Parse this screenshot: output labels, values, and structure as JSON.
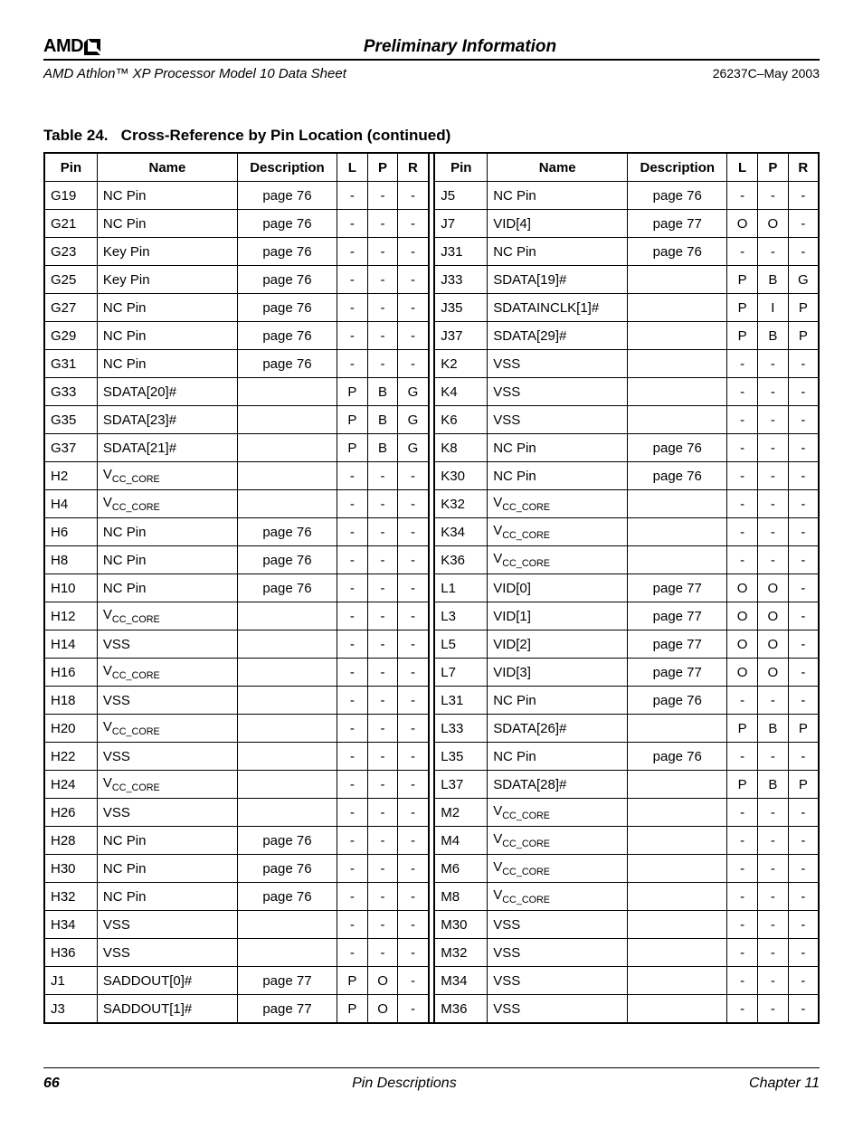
{
  "header": {
    "logo": "AMD",
    "preliminary": "Preliminary Information",
    "doc_title": "AMD Athlon™ XP Processor Model 10 Data Sheet",
    "doc_id": "26237C–May 2003"
  },
  "table": {
    "caption_prefix": "Table 24.",
    "caption_body": "Cross-Reference by Pin Location",
    "caption_suffix": "(continued)",
    "headers": {
      "pin": "Pin",
      "name": "Name",
      "desc": "Description",
      "l": "L",
      "p": "P",
      "r": "R"
    },
    "left": [
      {
        "pin": "G19",
        "name": "NC Pin",
        "desc": "page 76",
        "l": "-",
        "p": "-",
        "r": "-"
      },
      {
        "pin": "G21",
        "name": "NC Pin",
        "desc": "page 76",
        "l": "-",
        "p": "-",
        "r": "-"
      },
      {
        "pin": "G23",
        "name": "Key Pin",
        "desc": "page 76",
        "l": "-",
        "p": "-",
        "r": "-"
      },
      {
        "pin": "G25",
        "name": "Key Pin",
        "desc": "page 76",
        "l": "-",
        "p": "-",
        "r": "-"
      },
      {
        "pin": "G27",
        "name": "NC Pin",
        "desc": "page 76",
        "l": "-",
        "p": "-",
        "r": "-"
      },
      {
        "pin": "G29",
        "name": "NC Pin",
        "desc": "page 76",
        "l": "-",
        "p": "-",
        "r": "-"
      },
      {
        "pin": "G31",
        "name": "NC Pin",
        "desc": "page 76",
        "l": "-",
        "p": "-",
        "r": "-"
      },
      {
        "pin": "G33",
        "name": "SDATA[20]#",
        "desc": "",
        "l": "P",
        "p": "B",
        "r": "G"
      },
      {
        "pin": "G35",
        "name": "SDATA[23]#",
        "desc": "",
        "l": "P",
        "p": "B",
        "r": "G"
      },
      {
        "pin": "G37",
        "name": "SDATA[21]#",
        "desc": "",
        "l": "P",
        "p": "B",
        "r": "G"
      },
      {
        "pin": "H2",
        "name": "VCC_CORE",
        "desc": "",
        "l": "-",
        "p": "-",
        "r": "-"
      },
      {
        "pin": "H4",
        "name": "VCC_CORE",
        "desc": "",
        "l": "-",
        "p": "-",
        "r": "-"
      },
      {
        "pin": "H6",
        "name": "NC Pin",
        "desc": "page 76",
        "l": "-",
        "p": "-",
        "r": "-"
      },
      {
        "pin": "H8",
        "name": "NC Pin",
        "desc": "page 76",
        "l": "-",
        "p": "-",
        "r": "-"
      },
      {
        "pin": "H10",
        "name": "NC Pin",
        "desc": "page 76",
        "l": "-",
        "p": "-",
        "r": "-"
      },
      {
        "pin": "H12",
        "name": "VCC_CORE",
        "desc": "",
        "l": "-",
        "p": "-",
        "r": "-"
      },
      {
        "pin": "H14",
        "name": "VSS",
        "desc": "",
        "l": "-",
        "p": "-",
        "r": "-"
      },
      {
        "pin": "H16",
        "name": "VCC_CORE",
        "desc": "",
        "l": "-",
        "p": "-",
        "r": "-"
      },
      {
        "pin": "H18",
        "name": "VSS",
        "desc": "",
        "l": "-",
        "p": "-",
        "r": "-"
      },
      {
        "pin": "H20",
        "name": "VCC_CORE",
        "desc": "",
        "l": "-",
        "p": "-",
        "r": "-"
      },
      {
        "pin": "H22",
        "name": "VSS",
        "desc": "",
        "l": "-",
        "p": "-",
        "r": "-"
      },
      {
        "pin": "H24",
        "name": "VCC_CORE",
        "desc": "",
        "l": "-",
        "p": "-",
        "r": "-"
      },
      {
        "pin": "H26",
        "name": "VSS",
        "desc": "",
        "l": "-",
        "p": "-",
        "r": "-"
      },
      {
        "pin": "H28",
        "name": "NC Pin",
        "desc": "page 76",
        "l": "-",
        "p": "-",
        "r": "-"
      },
      {
        "pin": "H30",
        "name": "NC Pin",
        "desc": "page 76",
        "l": "-",
        "p": "-",
        "r": "-"
      },
      {
        "pin": "H32",
        "name": "NC Pin",
        "desc": "page 76",
        "l": "-",
        "p": "-",
        "r": "-"
      },
      {
        "pin": "H34",
        "name": "VSS",
        "desc": "",
        "l": "-",
        "p": "-",
        "r": "-"
      },
      {
        "pin": "H36",
        "name": "VSS",
        "desc": "",
        "l": "-",
        "p": "-",
        "r": "-"
      },
      {
        "pin": "J1",
        "name": "SADDOUT[0]#",
        "desc": "page 77",
        "l": "P",
        "p": "O",
        "r": "-"
      },
      {
        "pin": "J3",
        "name": "SADDOUT[1]#",
        "desc": "page 77",
        "l": "P",
        "p": "O",
        "r": "-"
      }
    ],
    "right": [
      {
        "pin": "J5",
        "name": "NC Pin",
        "desc": "page 76",
        "l": "-",
        "p": "-",
        "r": "-"
      },
      {
        "pin": "J7",
        "name": "VID[4]",
        "desc": "page 77",
        "l": "O",
        "p": "O",
        "r": "-"
      },
      {
        "pin": "J31",
        "name": "NC Pin",
        "desc": "page 76",
        "l": "-",
        "p": "-",
        "r": "-"
      },
      {
        "pin": "J33",
        "name": "SDATA[19]#",
        "desc": "",
        "l": "P",
        "p": "B",
        "r": "G"
      },
      {
        "pin": "J35",
        "name": "SDATAINCLK[1]#",
        "desc": "",
        "l": "P",
        "p": "I",
        "r": "P"
      },
      {
        "pin": "J37",
        "name": "SDATA[29]#",
        "desc": "",
        "l": "P",
        "p": "B",
        "r": "P"
      },
      {
        "pin": "K2",
        "name": "VSS",
        "desc": "",
        "l": "-",
        "p": "-",
        "r": "-"
      },
      {
        "pin": "K4",
        "name": "VSS",
        "desc": "",
        "l": "-",
        "p": "-",
        "r": "-"
      },
      {
        "pin": "K6",
        "name": "VSS",
        "desc": "",
        "l": "-",
        "p": "-",
        "r": "-"
      },
      {
        "pin": "K8",
        "name": "NC Pin",
        "desc": "page 76",
        "l": "-",
        "p": "-",
        "r": "-"
      },
      {
        "pin": "K30",
        "name": "NC Pin",
        "desc": "page 76",
        "l": "-",
        "p": "-",
        "r": "-"
      },
      {
        "pin": "K32",
        "name": "VCC_CORE",
        "desc": "",
        "l": "-",
        "p": "-",
        "r": "-"
      },
      {
        "pin": "K34",
        "name": "VCC_CORE",
        "desc": "",
        "l": "-",
        "p": "-",
        "r": "-"
      },
      {
        "pin": "K36",
        "name": "VCC_CORE",
        "desc": "",
        "l": "-",
        "p": "-",
        "r": "-"
      },
      {
        "pin": "L1",
        "name": "VID[0]",
        "desc": "page 77",
        "l": "O",
        "p": "O",
        "r": "-"
      },
      {
        "pin": "L3",
        "name": "VID[1]",
        "desc": "page 77",
        "l": "O",
        "p": "O",
        "r": "-"
      },
      {
        "pin": "L5",
        "name": "VID[2]",
        "desc": "page 77",
        "l": "O",
        "p": "O",
        "r": "-"
      },
      {
        "pin": "L7",
        "name": "VID[3]",
        "desc": "page 77",
        "l": "O",
        "p": "O",
        "r": "-"
      },
      {
        "pin": "L31",
        "name": "NC Pin",
        "desc": "page 76",
        "l": "-",
        "p": "-",
        "r": "-"
      },
      {
        "pin": "L33",
        "name": "SDATA[26]#",
        "desc": "",
        "l": "P",
        "p": "B",
        "r": "P"
      },
      {
        "pin": "L35",
        "name": "NC Pin",
        "desc": "page 76",
        "l": "-",
        "p": "-",
        "r": "-"
      },
      {
        "pin": "L37",
        "name": "SDATA[28]#",
        "desc": "",
        "l": "P",
        "p": "B",
        "r": "P"
      },
      {
        "pin": "M2",
        "name": "VCC_CORE",
        "desc": "",
        "l": "-",
        "p": "-",
        "r": "-"
      },
      {
        "pin": "M4",
        "name": "VCC_CORE",
        "desc": "",
        "l": "-",
        "p": "-",
        "r": "-"
      },
      {
        "pin": "M6",
        "name": "VCC_CORE",
        "desc": "",
        "l": "-",
        "p": "-",
        "r": "-"
      },
      {
        "pin": "M8",
        "name": "VCC_CORE",
        "desc": "",
        "l": "-",
        "p": "-",
        "r": "-"
      },
      {
        "pin": "M30",
        "name": "VSS",
        "desc": "",
        "l": "-",
        "p": "-",
        "r": "-"
      },
      {
        "pin": "M32",
        "name": "VSS",
        "desc": "",
        "l": "-",
        "p": "-",
        "r": "-"
      },
      {
        "pin": "M34",
        "name": "VSS",
        "desc": "",
        "l": "-",
        "p": "-",
        "r": "-"
      },
      {
        "pin": "M36",
        "name": "VSS",
        "desc": "",
        "l": "-",
        "p": "-",
        "r": "-"
      }
    ]
  },
  "footer": {
    "page": "66",
    "section": "Pin Descriptions",
    "chapter": "Chapter 11"
  }
}
